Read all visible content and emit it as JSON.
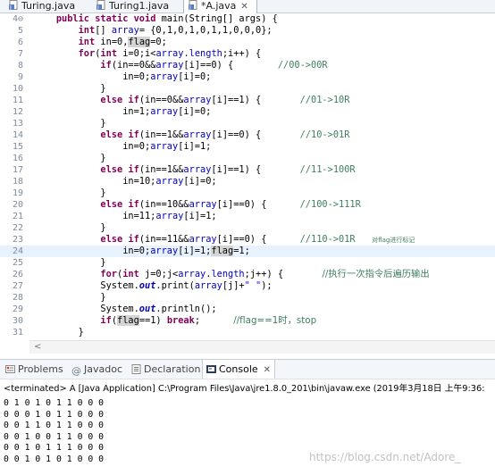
{
  "editor_tabs": [
    {
      "label": "Turing.java",
      "active": false
    },
    {
      "label": "Turing1.java",
      "active": false
    },
    {
      "label": "*A.java",
      "active": true,
      "close_glyph": "✕"
    }
  ],
  "code_lines": [
    {
      "num": "4⊖",
      "current": false,
      "parts": [
        [
          "p",
          "    "
        ],
        [
          "kw",
          "public static void"
        ],
        [
          "p",
          " main(String[] args) {"
        ]
      ]
    },
    {
      "num": "5",
      "current": false,
      "parts": [
        [
          "p",
          "        "
        ],
        [
          "kw",
          "int"
        ],
        [
          "p",
          "[] "
        ],
        [
          "fld",
          "array"
        ],
        [
          "p",
          "= {0,1,0,1,0,1,1,0,0,0};"
        ]
      ]
    },
    {
      "num": "6",
      "current": false,
      "parts": [
        [
          "p",
          "        "
        ],
        [
          "kw",
          "int"
        ],
        [
          "p",
          " in=0,"
        ],
        [
          "hl",
          "flag"
        ],
        [
          "p",
          "=0;"
        ]
      ]
    },
    {
      "num": "7",
      "current": false,
      "parts": [
        [
          "p",
          "        "
        ],
        [
          "kw",
          "for"
        ],
        [
          "p",
          "("
        ],
        [
          "kw",
          "int"
        ],
        [
          "p",
          " i=0;i<"
        ],
        [
          "fld",
          "array"
        ],
        [
          "p",
          "."
        ],
        [
          "fld",
          "length"
        ],
        [
          "p",
          ";i++) {"
        ]
      ]
    },
    {
      "num": "8",
      "current": false,
      "parts": [
        [
          "p",
          "            "
        ],
        [
          "kw",
          "if"
        ],
        [
          "p",
          "(in==0&&"
        ],
        [
          "fld",
          "array"
        ],
        [
          "p",
          "[i]==0) {        "
        ],
        [
          "cmt",
          "//00->00R"
        ]
      ]
    },
    {
      "num": "9",
      "current": false,
      "parts": [
        [
          "p",
          "                in=0;"
        ],
        [
          "fld",
          "array"
        ],
        [
          "p",
          "[i]=0;"
        ]
      ]
    },
    {
      "num": "10",
      "current": false,
      "parts": [
        [
          "p",
          "            }"
        ]
      ]
    },
    {
      "num": "11",
      "current": false,
      "parts": [
        [
          "p",
          "            "
        ],
        [
          "kw",
          "else if"
        ],
        [
          "p",
          "(in==0&&"
        ],
        [
          "fld",
          "array"
        ],
        [
          "p",
          "[i]==1) {       "
        ],
        [
          "cmt",
          "//01->10R"
        ]
      ]
    },
    {
      "num": "12",
      "current": false,
      "parts": [
        [
          "p",
          "                in=1;"
        ],
        [
          "fld",
          "array"
        ],
        [
          "p",
          "[i]=0;"
        ]
      ]
    },
    {
      "num": "13",
      "current": false,
      "parts": [
        [
          "p",
          "            }"
        ]
      ]
    },
    {
      "num": "14",
      "current": false,
      "parts": [
        [
          "p",
          "            "
        ],
        [
          "kw",
          "else if"
        ],
        [
          "p",
          "(in==1&&"
        ],
        [
          "fld",
          "array"
        ],
        [
          "p",
          "[i]==0) {       "
        ],
        [
          "cmt",
          "//10->01R"
        ]
      ]
    },
    {
      "num": "15",
      "current": false,
      "parts": [
        [
          "p",
          "                in=0;"
        ],
        [
          "fld",
          "array"
        ],
        [
          "p",
          "[i]=1;"
        ]
      ]
    },
    {
      "num": "16",
      "current": false,
      "parts": [
        [
          "p",
          "            }"
        ]
      ]
    },
    {
      "num": "17",
      "current": false,
      "parts": [
        [
          "p",
          "            "
        ],
        [
          "kw",
          "else if"
        ],
        [
          "p",
          "(in==1&&"
        ],
        [
          "fld",
          "array"
        ],
        [
          "p",
          "[i]==1) {       "
        ],
        [
          "cmt",
          "//11->100R"
        ]
      ]
    },
    {
      "num": "18",
      "current": false,
      "parts": [
        [
          "p",
          "                in=10;"
        ],
        [
          "fld",
          "array"
        ],
        [
          "p",
          "[i]=0;"
        ]
      ]
    },
    {
      "num": "19",
      "current": false,
      "parts": [
        [
          "p",
          "            }"
        ]
      ]
    },
    {
      "num": "20",
      "current": false,
      "parts": [
        [
          "p",
          "            "
        ],
        [
          "kw",
          "else if"
        ],
        [
          "p",
          "(in==10&&"
        ],
        [
          "fld",
          "array"
        ],
        [
          "p",
          "[i]==0) {      "
        ],
        [
          "cmt",
          "//100->111R"
        ]
      ]
    },
    {
      "num": "21",
      "current": false,
      "parts": [
        [
          "p",
          "                in=11;"
        ],
        [
          "fld",
          "array"
        ],
        [
          "p",
          "[i]=1;"
        ]
      ]
    },
    {
      "num": "22",
      "current": false,
      "parts": [
        [
          "p",
          "            }"
        ]
      ]
    },
    {
      "num": "23",
      "current": false,
      "parts": [
        [
          "p",
          "            "
        ],
        [
          "kw",
          "else if"
        ],
        [
          "p",
          "(in==11&&"
        ],
        [
          "fld",
          "array"
        ],
        [
          "p",
          "[i]==0) {      "
        ],
        [
          "cmt",
          "//110->01R"
        ],
        [
          "p",
          "   "
        ],
        [
          "cmts",
          "对flag进行标记"
        ]
      ]
    },
    {
      "num": "24",
      "current": true,
      "parts": [
        [
          "p",
          "                in=0;"
        ],
        [
          "fld",
          "array"
        ],
        [
          "p",
          "[i]=1;"
        ],
        [
          "hl",
          "flag"
        ],
        [
          "p",
          "=1;"
        ]
      ]
    },
    {
      "num": "25",
      "current": false,
      "parts": [
        [
          "p",
          "            }"
        ]
      ]
    },
    {
      "num": "26",
      "current": false,
      "parts": [
        [
          "p",
          "            "
        ],
        [
          "kw",
          "for"
        ],
        [
          "p",
          "("
        ],
        [
          "kw",
          "int"
        ],
        [
          "p",
          " j=0;j<"
        ],
        [
          "fld",
          "array"
        ],
        [
          "p",
          "."
        ],
        [
          "fld",
          "length"
        ],
        [
          "p",
          ";j++) {       "
        ],
        [
          "cmtc",
          "//执行一次指令后遍历输出"
        ]
      ]
    },
    {
      "num": "27",
      "current": false,
      "parts": [
        [
          "p",
          "            System."
        ],
        [
          "sfld",
          "out"
        ],
        [
          "p",
          ".print("
        ],
        [
          "fld",
          "array"
        ],
        [
          "p",
          "[j]+"
        ],
        [
          "str",
          "\" \""
        ],
        [
          "p",
          ");"
        ]
      ]
    },
    {
      "num": "28",
      "current": false,
      "parts": [
        [
          "p",
          "            }"
        ]
      ]
    },
    {
      "num": "29",
      "current": false,
      "parts": [
        [
          "p",
          "            System."
        ],
        [
          "sfld",
          "out"
        ],
        [
          "p",
          ".println();"
        ]
      ]
    },
    {
      "num": "30",
      "current": false,
      "parts": [
        [
          "p",
          "            "
        ],
        [
          "kw",
          "if"
        ],
        [
          "p",
          "("
        ],
        [
          "hl",
          "flag"
        ],
        [
          "p",
          "==1) "
        ],
        [
          "kw",
          "break"
        ],
        [
          "p",
          ";      "
        ],
        [
          "cmtc",
          "//flag==1时，stop"
        ]
      ]
    },
    {
      "num": "31",
      "current": false,
      "parts": [
        [
          "p",
          "        }"
        ]
      ]
    }
  ],
  "scroll_arrow": "<",
  "views": {
    "tabs": [
      {
        "label": "Problems",
        "active": false
      },
      {
        "label": "Javadoc",
        "active": false
      },
      {
        "label": "Declaration",
        "active": false
      },
      {
        "label": "Console",
        "active": true,
        "close_glyph": "✕"
      }
    ]
  },
  "console": {
    "terminated": "<terminated> A [Java Application] C:\\Program Files\\Java\\jre1.8.0_201\\bin\\javaw.exe (2019年3月18日 上午9:36:",
    "output": [
      "0 1 0 1 0 1 1 0 0 0",
      "0 0 0 1 0 1 1 0 0 0",
      "0 0 1 1 0 1 1 0 0 0",
      "0 0 1 0 0 1 1 0 0 0",
      "0 0 1 0 1 1 1 0 0 0",
      "0 0 1 0 1 0 1 0 0 0"
    ]
  },
  "watermark": "https://blog.csdn.net/Adore_",
  "colors": {
    "keyword": "#7f0055",
    "field": "#0000c0",
    "comment": "#3f7f5f",
    "string": "#2a00ff",
    "current_line": "#e8f2fe",
    "occurrence_highlight": "#d4d4d4"
  }
}
